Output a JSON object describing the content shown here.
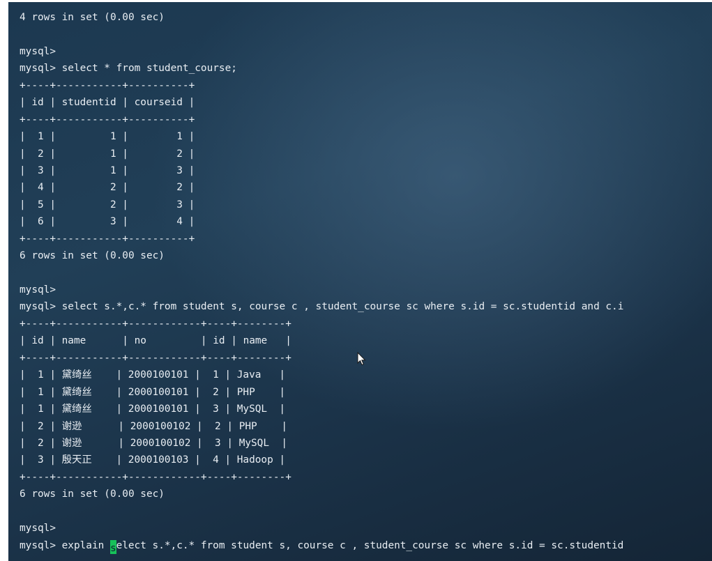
{
  "terminal": {
    "lines": [
      "4 rows in set (0.00 sec)",
      "",
      "mysql>",
      "mysql> select * from student_course;",
      "+----+-----------+----------+",
      "| id | studentid | courseid |",
      "+----+-----------+----------+",
      "|  1 |         1 |        1 |",
      "|  2 |         1 |        2 |",
      "|  3 |         1 |        3 |",
      "|  4 |         2 |        2 |",
      "|  5 |         2 |        3 |",
      "|  6 |         3 |        4 |",
      "+----+-----------+----------+",
      "6 rows in set (0.00 sec)",
      "",
      "mysql>",
      "mysql> select s.*,c.* from student s, course c , student_course sc where s.id = sc.studentid and c.i",
      "+----+-----------+------------+----+--------+",
      "| id | name      | no         | id | name   |",
      "+----+-----------+------------+----+--------+",
      "|  1 | 黛绮丝    | 2000100101 |  1 | Java   |",
      "|  1 | 黛绮丝    | 2000100101 |  2 | PHP    |",
      "|  1 | 黛绮丝    | 2000100101 |  3 | MySQL  |",
      "|  2 | 谢逊      | 2000100102 |  2 | PHP    |",
      "|  2 | 谢逊      | 2000100102 |  3 | MySQL  |",
      "|  3 | 殷天正    | 2000100103 |  4 | Hadoop |",
      "+----+-----------+------------+----+--------+",
      "6 rows in set (0.00 sec)",
      "",
      "mysql>"
    ],
    "input_line": {
      "prompt_and_before_cursor": "mysql> explain ",
      "cursor_char": "s",
      "after_cursor": "elect s.*,c.* from student s, course c , student_course sc where s.id = sc.studentid"
    }
  }
}
